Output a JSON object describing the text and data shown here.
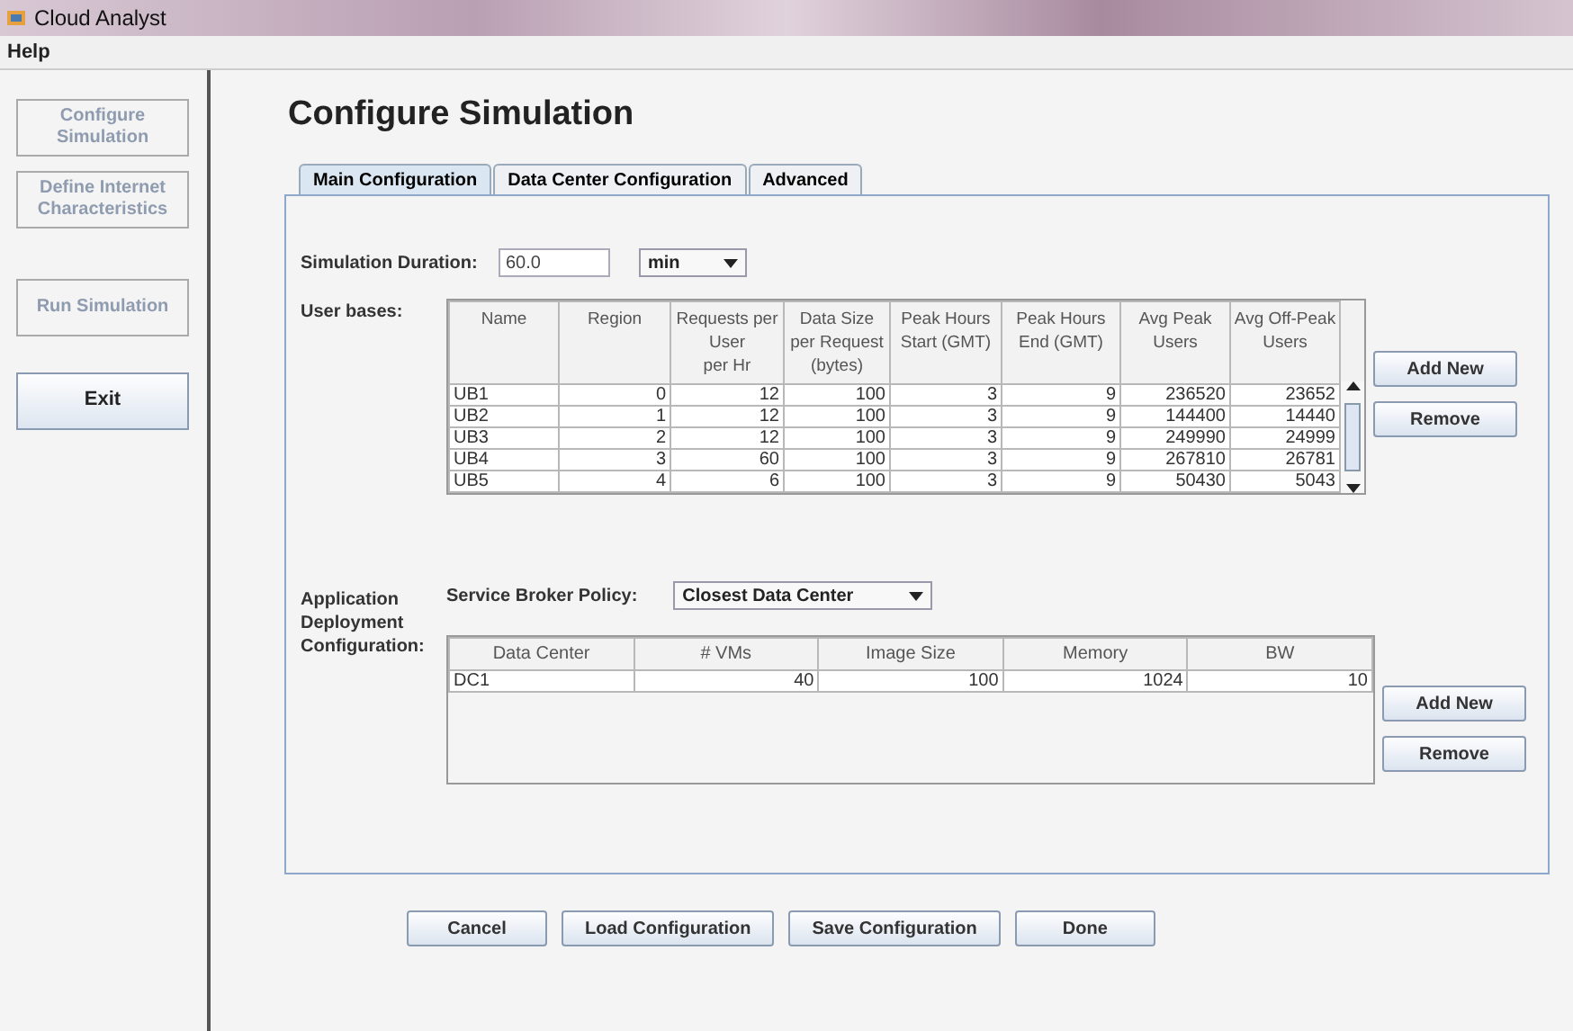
{
  "window": {
    "title": "Cloud Analyst"
  },
  "menu": [
    "Help"
  ],
  "sidebar": {
    "items": [
      {
        "label": "Configure Simulation",
        "disabled": true
      },
      {
        "label": "Define Internet Characteristics",
        "disabled": true
      },
      {
        "label": "Run Simulation",
        "disabled": true
      },
      {
        "label": "Exit",
        "disabled": false
      }
    ]
  },
  "heading": "Configure Simulation",
  "tabs": [
    {
      "label": "Main Configuration",
      "selected": true
    },
    {
      "label": "Data Center Configuration",
      "selected": false
    },
    {
      "label": "Advanced",
      "selected": false
    }
  ],
  "duration": {
    "label": "Simulation Duration:",
    "value": "60.0",
    "unit": "min"
  },
  "user_bases": {
    "label": "User bases:",
    "columns": [
      "Name",
      "Region",
      "Requests per\nUser\nper Hr",
      "Data Size\nper Request\n(bytes)",
      "Peak Hours\nStart (GMT)",
      "Peak Hours\nEnd (GMT)",
      "Avg Peak\nUsers",
      "Avg Off-Peak\nUsers"
    ],
    "rows": [
      [
        "UB1",
        "0",
        "12",
        "100",
        "3",
        "9",
        "236520",
        "23652"
      ],
      [
        "UB2",
        "1",
        "12",
        "100",
        "3",
        "9",
        "144400",
        "14440"
      ],
      [
        "UB3",
        "2",
        "12",
        "100",
        "3",
        "9",
        "249990",
        "24999"
      ],
      [
        "UB4",
        "3",
        "60",
        "100",
        "3",
        "9",
        "267810",
        "26781"
      ],
      [
        "UB5",
        "4",
        "6",
        "100",
        "3",
        "9",
        "50430",
        "5043"
      ]
    ],
    "buttons": [
      "Add New",
      "Remove"
    ]
  },
  "deployment": {
    "label": "Application Deployment Configuration:",
    "policy_label": "Service Broker Policy:",
    "policy": "Closest Data Center",
    "columns": [
      "Data Center",
      "# VMs",
      "Image Size",
      "Memory",
      "BW"
    ],
    "rows": [
      [
        "DC1",
        "40",
        "100",
        "1024",
        "10"
      ]
    ],
    "buttons": [
      "Add New",
      "Remove"
    ]
  },
  "footer_buttons": [
    "Cancel",
    "Load Configuration",
    "Save Configuration",
    "Done"
  ]
}
